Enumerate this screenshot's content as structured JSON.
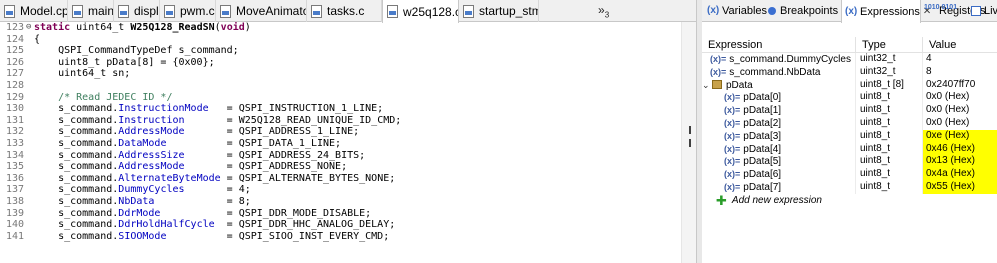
{
  "editor": {
    "tabs": [
      {
        "label": "Model.cpp",
        "active": false
      },
      {
        "label": "main.c",
        "active": false
      },
      {
        "label": "display.c",
        "active": false
      },
      {
        "label": "pwm.c",
        "active": false
      },
      {
        "label": "MoveAnimato...",
        "active": false
      },
      {
        "label": "tasks.c",
        "active": false
      },
      {
        "label": "w25q128.c",
        "active": true
      },
      {
        "label": "startup_stm...",
        "active": false
      }
    ],
    "overflow_label": "»",
    "overflow_count": "3",
    "lines": [
      {
        "num": "123",
        "fold": "⊖",
        "tokens": [
          {
            "c": "kw",
            "t": "static "
          },
          {
            "c": "txt",
            "t": "uint64_t "
          },
          {
            "c": "fn",
            "t": "W25Q128_ReadSN"
          },
          {
            "c": "txt",
            "t": "("
          },
          {
            "c": "kw",
            "t": "void"
          },
          {
            "c": "txt",
            "t": ")"
          }
        ]
      },
      {
        "num": "124",
        "fold": "",
        "tokens": [
          {
            "c": "txt",
            "t": "{"
          }
        ]
      },
      {
        "num": "125",
        "fold": "",
        "tokens": [
          {
            "c": "txt",
            "t": "    QSPI_CommandTypeDef s_command;"
          }
        ]
      },
      {
        "num": "126",
        "fold": "",
        "tokens": [
          {
            "c": "txt",
            "t": "    uint8_t pData[8] = {0x00};"
          }
        ]
      },
      {
        "num": "127",
        "fold": "",
        "tokens": [
          {
            "c": "txt",
            "t": "    uint64_t sn;"
          }
        ]
      },
      {
        "num": "128",
        "fold": "",
        "tokens": [
          {
            "c": "txt",
            "t": ""
          }
        ]
      },
      {
        "num": "129",
        "fold": "",
        "tokens": [
          {
            "c": "cmt",
            "t": "    /* Read JEDEC ID */"
          }
        ]
      },
      {
        "num": "130",
        "fold": "",
        "tokens": [
          {
            "c": "txt",
            "t": "    s_command."
          },
          {
            "c": "mem",
            "t": "InstructionMode"
          },
          {
            "c": "txt",
            "t": "   = QSPI_INSTRUCTION_1_LINE;"
          }
        ]
      },
      {
        "num": "131",
        "fold": "",
        "tokens": [
          {
            "c": "txt",
            "t": "    s_command."
          },
          {
            "c": "mem",
            "t": "Instruction"
          },
          {
            "c": "txt",
            "t": "       = W25Q128_READ_UNIQUE_ID_CMD;"
          }
        ]
      },
      {
        "num": "132",
        "fold": "",
        "tokens": [
          {
            "c": "txt",
            "t": "    s_command."
          },
          {
            "c": "mem",
            "t": "AddressMode"
          },
          {
            "c": "txt",
            "t": "       = QSPI_ADDRESS_1_LINE;"
          }
        ]
      },
      {
        "num": "133",
        "fold": "",
        "tokens": [
          {
            "c": "txt",
            "t": "    s_command."
          },
          {
            "c": "mem",
            "t": "DataMode"
          },
          {
            "c": "txt",
            "t": "          = QSPI_DATA_1_LINE;"
          }
        ]
      },
      {
        "num": "134",
        "fold": "",
        "tokens": [
          {
            "c": "txt",
            "t": "    s_command."
          },
          {
            "c": "mem",
            "t": "AddressSize"
          },
          {
            "c": "txt",
            "t": "       = QSPI_ADDRESS_24_BITS;"
          }
        ]
      },
      {
        "num": "135",
        "fold": "",
        "tokens": [
          {
            "c": "txt",
            "t": "    s_command."
          },
          {
            "c": "mem",
            "t": "AddressMode"
          },
          {
            "c": "txt",
            "t": "       = QSPI_ADDRESS_NONE;"
          }
        ]
      },
      {
        "num": "136",
        "fold": "",
        "tokens": [
          {
            "c": "txt",
            "t": "    s_command."
          },
          {
            "c": "mem",
            "t": "AlternateByteMode"
          },
          {
            "c": "txt",
            "t": " = QSPI_ALTERNATE_BYTES_NONE;"
          }
        ]
      },
      {
        "num": "137",
        "fold": "",
        "tokens": [
          {
            "c": "txt",
            "t": "    s_command."
          },
          {
            "c": "mem",
            "t": "DummyCycles"
          },
          {
            "c": "txt",
            "t": "       = 4;"
          }
        ]
      },
      {
        "num": "138",
        "fold": "",
        "tokens": [
          {
            "c": "txt",
            "t": "    s_command."
          },
          {
            "c": "mem",
            "t": "NbData"
          },
          {
            "c": "txt",
            "t": "            = 8;"
          }
        ]
      },
      {
        "num": "139",
        "fold": "",
        "tokens": [
          {
            "c": "txt",
            "t": "    s_command."
          },
          {
            "c": "mem",
            "t": "DdrMode"
          },
          {
            "c": "txt",
            "t": "           = QSPI_DDR_MODE_DISABLE;"
          }
        ]
      },
      {
        "num": "140",
        "fold": "",
        "tokens": [
          {
            "c": "txt",
            "t": "    s_command."
          },
          {
            "c": "mem",
            "t": "DdrHoldHalfCycle"
          },
          {
            "c": "txt",
            "t": "  = QSPI_DDR_HHC_ANALOG_DELAY;"
          }
        ]
      },
      {
        "num": "141",
        "fold": "",
        "tokens": [
          {
            "c": "txt",
            "t": "    s_command."
          },
          {
            "c": "mem",
            "t": "SIOOMode"
          },
          {
            "c": "txt",
            "t": "          = QSPI_SIOO_INST_EVERY_CMD;"
          }
        ]
      }
    ]
  },
  "views": {
    "tabs": [
      {
        "label": "Variables",
        "icon": "variables-icon"
      },
      {
        "label": "Breakpoints",
        "icon": "breakpoints-icon"
      },
      {
        "label": "Expressions",
        "icon": "expressions-icon",
        "active": true
      },
      {
        "label": "Registers",
        "icon": "registers-icon"
      },
      {
        "label": "Live",
        "icon": "live-expressions-icon"
      }
    ],
    "columns": {
      "expression": "Expression",
      "type": "Type",
      "value": "Value"
    },
    "rows": [
      {
        "expr": "s_command.DummyCycles",
        "type": "uint32_t",
        "value": "4",
        "kind": "var",
        "indent": 0,
        "highlight": false
      },
      {
        "expr": "s_command.NbData",
        "type": "uint32_t",
        "value": "8",
        "kind": "var",
        "indent": 0,
        "highlight": false
      },
      {
        "expr": "pData",
        "type": "uint8_t [8]",
        "value": "0x2407ff70",
        "kind": "ptr",
        "indent": 0,
        "expanded": true,
        "highlight": false
      },
      {
        "expr": "pData[0]",
        "type": "uint8_t",
        "value": "0x0 (Hex)",
        "kind": "var",
        "indent": 1,
        "highlight": false
      },
      {
        "expr": "pData[1]",
        "type": "uint8_t",
        "value": "0x0 (Hex)",
        "kind": "var",
        "indent": 1,
        "highlight": false
      },
      {
        "expr": "pData[2]",
        "type": "uint8_t",
        "value": "0x0 (Hex)",
        "kind": "var",
        "indent": 1,
        "highlight": false
      },
      {
        "expr": "pData[3]",
        "type": "uint8_t",
        "value": "0xe (Hex)",
        "kind": "var",
        "indent": 1,
        "highlight": true
      },
      {
        "expr": "pData[4]",
        "type": "uint8_t",
        "value": "0x46 (Hex)",
        "kind": "var",
        "indent": 1,
        "highlight": true
      },
      {
        "expr": "pData[5]",
        "type": "uint8_t",
        "value": "0x13 (Hex)",
        "kind": "var",
        "indent": 1,
        "highlight": true
      },
      {
        "expr": "pData[6]",
        "type": "uint8_t",
        "value": "0x4a (Hex)",
        "kind": "var",
        "indent": 1,
        "highlight": true
      },
      {
        "expr": "pData[7]",
        "type": "uint8_t",
        "value": "0x55 (Hex)",
        "kind": "var",
        "indent": 1,
        "highlight": true
      }
    ],
    "add_expression": "Add new expression",
    "highlight_color": "#ffff00"
  }
}
